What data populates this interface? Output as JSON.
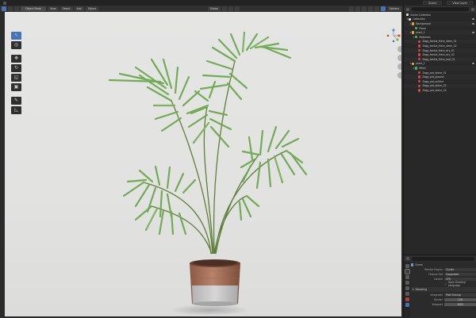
{
  "topbar": {
    "scene_label": "Scene",
    "view_layer_label": "View Layer"
  },
  "viewport_header": {
    "mode_label": "Object Mode",
    "menus": [
      "View",
      "Select",
      "Add",
      "Object"
    ],
    "orientation_label": "Global",
    "options_label": "Options"
  },
  "outliner": {
    "title": "Scene Collection",
    "rows": [
      {
        "indent": 0,
        "icon": "coll",
        "label": "Collection",
        "expanded": true
      },
      {
        "indent": 1,
        "icon": "obj",
        "label": "Background",
        "expanded": true
      },
      {
        "indent": 2,
        "icon": "mesh",
        "label": "Plane",
        "expanded": false
      },
      {
        "indent": 1,
        "icon": "obj",
        "label": "plant_1 ",
        "expanded": true
      },
      {
        "indent": 2,
        "icon": "mesh",
        "label": "Materials",
        "expanded": true
      },
      {
        "indent": 3,
        "icon": "mat",
        "label": "Zagg_kentia_frdsn_stem_01",
        "expanded": false
      },
      {
        "indent": 3,
        "icon": "mat",
        "label": "Zagg_kentia_frdsn_stem_02",
        "expanded": false
      },
      {
        "indent": 3,
        "icon": "mat",
        "label": "Zagg_kentia_frdsn_dry_01",
        "expanded": false
      },
      {
        "indent": 3,
        "icon": "mat",
        "label": "Zagg_kentia_frdsn_dry_02",
        "expanded": false
      },
      {
        "indent": 3,
        "icon": "mat",
        "label": "Zagg_kentia_frdsn_leaf_01",
        "expanded": false
      },
      {
        "indent": 1,
        "icon": "obj",
        "label": "plant_1 ",
        "expanded": true
      },
      {
        "indent": 2,
        "icon": "mesh",
        "label": "Mesh",
        "expanded": true
      },
      {
        "indent": 3,
        "icon": "mat",
        "label": "Zagg_pot_stone_01",
        "expanded": false
      },
      {
        "indent": 3,
        "icon": "mat",
        "label": "Zagg_pot_ground",
        "expanded": false
      },
      {
        "indent": 3,
        "icon": "mat",
        "label": "Zagg_pot_outline",
        "expanded": false
      },
      {
        "indent": 3,
        "icon": "mat",
        "label": "Zagg_pot_stone_02",
        "expanded": false
      },
      {
        "indent": 3,
        "icon": "mat",
        "label": "Zagg_pot_stone_03",
        "expanded": false
      }
    ]
  },
  "properties": {
    "context_label": "Scene",
    "render_engine": {
      "label": "Render Engine",
      "value": "Cycles"
    },
    "feature_set": {
      "label": "Feature Set",
      "value": "Supported"
    },
    "device": {
      "label": "Device",
      "value": "CPU"
    },
    "open_shading": "Open Shading Language",
    "sampling_label": "Sampling",
    "integrator": {
      "label": "Integrator",
      "value": "Path Tracing"
    },
    "render_samples": {
      "label": "Render",
      "value": "128"
    },
    "viewport_samples": {
      "label": "Viewport",
      "value": "1000"
    }
  },
  "colors": {
    "accent": "#4772b3",
    "viewport_bg": "#e3e3e2",
    "leaf": "#6fae55",
    "pot_wood": "#a9735a",
    "pot_stone": "#c8c8c8"
  }
}
